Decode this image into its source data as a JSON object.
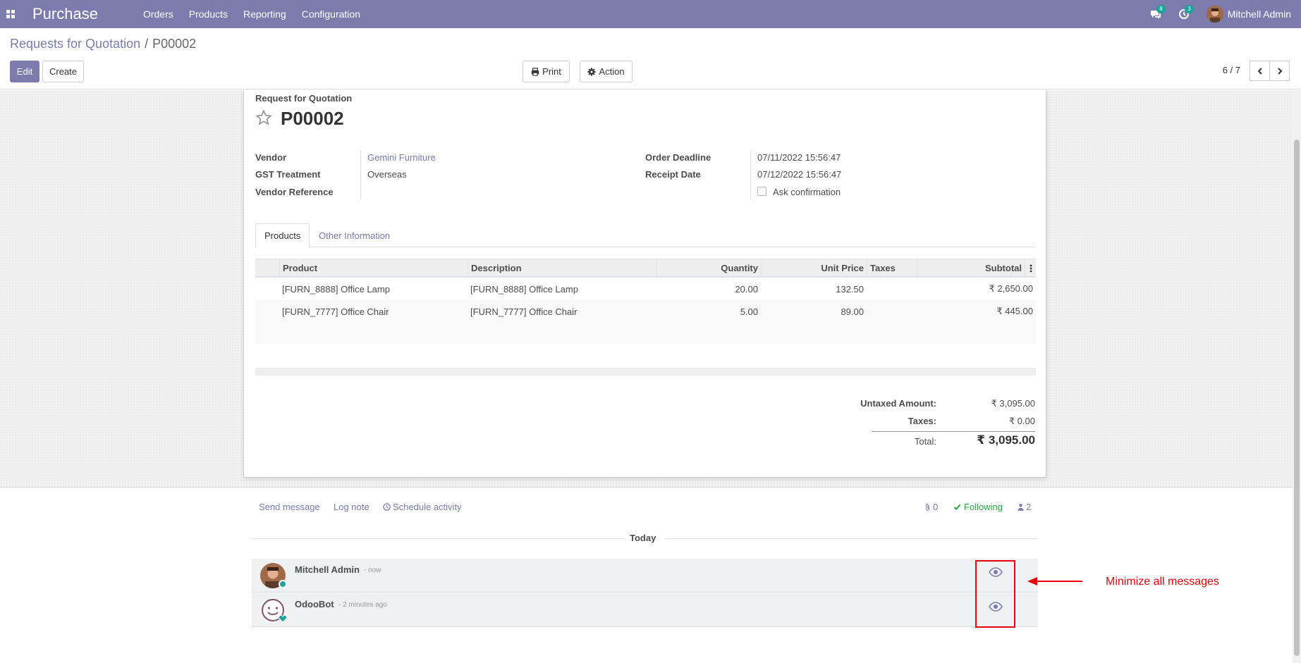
{
  "navbar": {
    "app_name": "Purchase",
    "menu": [
      "Orders",
      "Products",
      "Reporting",
      "Configuration"
    ],
    "messages_count": "8",
    "activities_count": "3",
    "user_name": "Mitchell Admin",
    "bg_color": "#7c7bad"
  },
  "control_panel": {
    "breadcrumb_parent": "Requests for Quotation",
    "breadcrumb_sep": "/",
    "breadcrumb_current": "P00002",
    "edit_label": "Edit",
    "create_label": "Create",
    "print_label": "Print",
    "action_label": "Action",
    "pager": "6 / 7"
  },
  "form": {
    "doc_type": "Request for Quotation",
    "name": "P00002",
    "vendor_label": "Vendor",
    "vendor_value": "Gemini Furniture",
    "gst_label": "GST Treatment",
    "gst_value": "Overseas",
    "vendor_ref_label": "Vendor Reference",
    "deadline_label": "Order Deadline",
    "deadline_value": "07/11/2022 15:56:47",
    "receipt_label": "Receipt Date",
    "receipt_value": "07/12/2022 15:56:47",
    "ask_confirm_label": "Ask confirmation",
    "tabs": [
      "Products",
      "Other Information"
    ]
  },
  "order_lines": {
    "headers": {
      "product": "Product",
      "description": "Description",
      "quantity": "Quantity",
      "unit_price": "Unit Price",
      "taxes": "Taxes",
      "subtotal": "Subtotal"
    },
    "rows": [
      {
        "product": "[FURN_8888] Office Lamp",
        "description": "[FURN_8888] Office Lamp",
        "quantity": "20.00",
        "unit_price": "132.50",
        "taxes": "",
        "subtotal": "₹ 2,650.00"
      },
      {
        "product": "[FURN_7777] Office Chair",
        "description": "[FURN_7777] Office Chair",
        "quantity": "5.00",
        "unit_price": "89.00",
        "taxes": "",
        "subtotal": "₹ 445.00"
      }
    ]
  },
  "totals": {
    "untaxed_label": "Untaxed Amount:",
    "untaxed_value": "₹ 3,095.00",
    "taxes_label": "Taxes:",
    "taxes_value": "₹ 0.00",
    "total_label": "Total:",
    "total_value": "₹ 3,095.00"
  },
  "chatter": {
    "send_message": "Send message",
    "log_note": "Log note",
    "schedule_activity": "Schedule activity",
    "attachments_count": "0",
    "following_label": "Following",
    "followers_count": "2",
    "date_separator": "Today",
    "messages": [
      {
        "author": "Mitchell Admin",
        "date": "- now"
      },
      {
        "author": "OdooBot",
        "date": "- 2 minutes ago"
      }
    ]
  },
  "annotation": {
    "text": "Minimize all messages",
    "color": "#e8000b"
  }
}
